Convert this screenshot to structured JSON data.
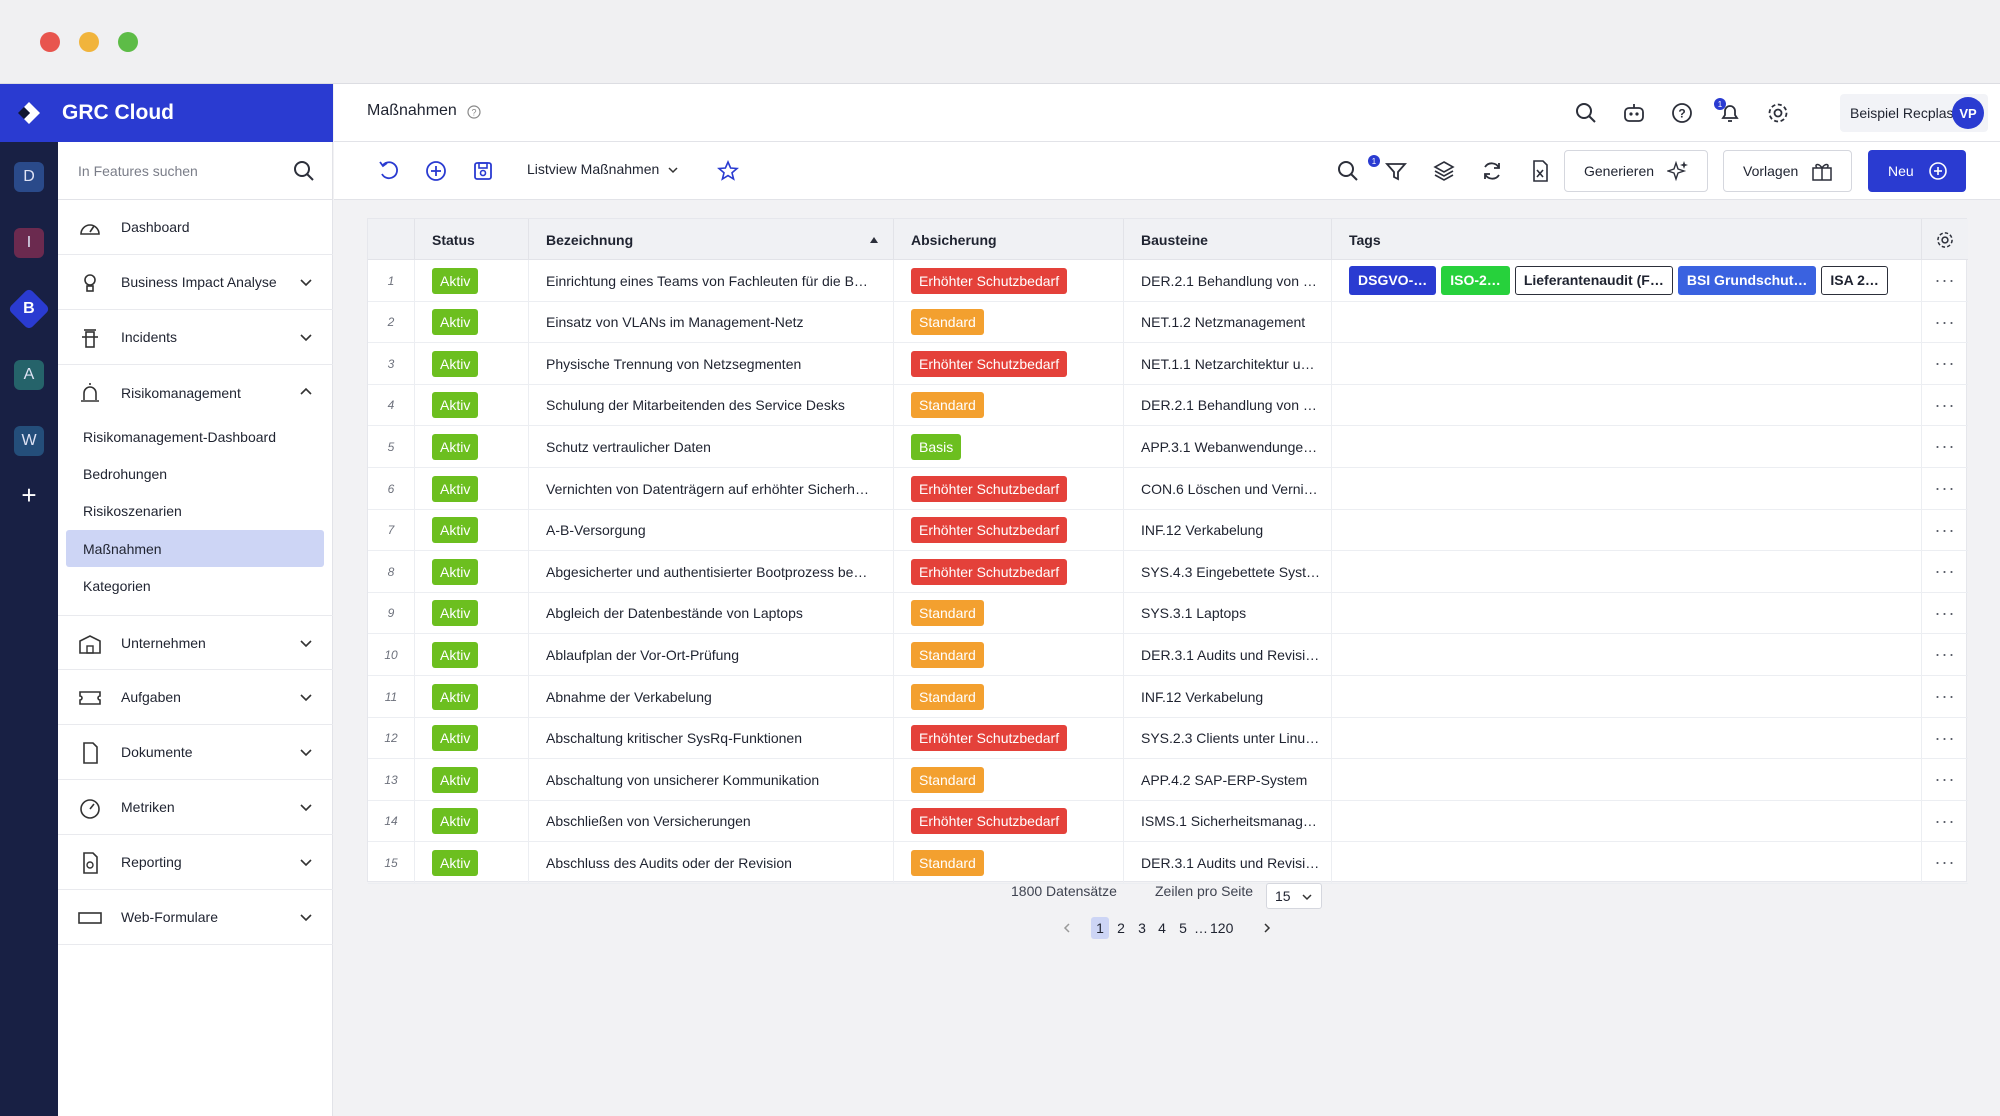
{
  "app": {
    "name": "GRC Cloud",
    "rail_items": [
      "D",
      "I",
      "B",
      "A",
      "W"
    ]
  },
  "sidebar": {
    "search_placeholder": "In Features suchen",
    "items": [
      {
        "label": "Dashboard",
        "icon": "dashboard-icon",
        "expandable": false
      },
      {
        "label": "Business Impact Analyse",
        "icon": "lightbulb-icon",
        "expandable": true
      },
      {
        "label": "Incidents",
        "icon": "fire-hydrant-icon",
        "expandable": true
      },
      {
        "label": "Risikomanagement",
        "icon": "alarm-light-icon",
        "expandable": true,
        "expanded": true
      },
      {
        "label": "Unternehmen",
        "icon": "building-icon",
        "expandable": true
      },
      {
        "label": "Aufgaben",
        "icon": "ticket-icon",
        "expandable": true
      },
      {
        "label": "Dokumente",
        "icon": "document-icon",
        "expandable": true
      },
      {
        "label": "Metriken",
        "icon": "gauge-icon",
        "expandable": true
      },
      {
        "label": "Reporting",
        "icon": "report-icon",
        "expandable": true
      },
      {
        "label": "Web-Formulare",
        "icon": "form-icon",
        "expandable": true
      }
    ],
    "sub_items": [
      "Risikomanagement-Dashboard",
      "Bedrohungen",
      "Risikoszenarien",
      "Maßnahmen",
      "Kategorien"
    ],
    "active_sub_item": "Maßnahmen"
  },
  "header": {
    "title": "Maßnahmen",
    "notification_count": "1",
    "user_name": "Beispiel Recplast",
    "user_initials": "VP"
  },
  "toolbar": {
    "view_label": "Listview Maßnahmen",
    "filter_count": "1",
    "generate_label": "Generieren",
    "templates_label": "Vorlagen",
    "new_label": "Neu"
  },
  "table": {
    "columns": [
      "Status",
      "Bezeichnung",
      "Absicherung",
      "Bausteine",
      "Tags"
    ],
    "sort_column": "Bezeichnung",
    "sort_direction": "ascending",
    "rows": [
      {
        "num": "1",
        "status": "Aktiv",
        "name": "Einrichtung eines Teams von Fachleuten für die B…",
        "level": "Erhöhter Schutzbedarf",
        "module": "DER.2.1 Behandlung von …"
      },
      {
        "num": "2",
        "status": "Aktiv",
        "name": "Einsatz von VLANs im Management-Netz",
        "level": "Standard",
        "module": "NET.1.2 Netzmanagement"
      },
      {
        "num": "3",
        "status": "Aktiv",
        "name": "Physische Trennung von Netzsegmenten",
        "level": "Erhöhter Schutzbedarf",
        "module": "NET.1.1 Netzarchitektur u…"
      },
      {
        "num": "4",
        "status": "Aktiv",
        "name": "Schulung der Mitarbeitenden des Service Desks",
        "level": "Standard",
        "module": "DER.2.1 Behandlung von …"
      },
      {
        "num": "5",
        "status": "Aktiv",
        "name": "Schutz vertraulicher Daten",
        "level": "Basis",
        "module": "APP.3.1 Webanwendunge…"
      },
      {
        "num": "6",
        "status": "Aktiv",
        "name": "Vernichten von Datenträgern auf erhöhter Sicherh…",
        "level": "Erhöhter Schutzbedarf",
        "module": "CON.6 Löschen und Verni…"
      },
      {
        "num": "7",
        "status": "Aktiv",
        "name": "A-B-Versorgung",
        "level": "Erhöhter Schutzbedarf",
        "module": "INF.12 Verkabelung"
      },
      {
        "num": "8",
        "status": "Aktiv",
        "name": "Abgesicherter und authentisierter Bootprozess be…",
        "level": "Erhöhter Schutzbedarf",
        "module": "SYS.4.3 Eingebettete Syst…"
      },
      {
        "num": "9",
        "status": "Aktiv",
        "name": "Abgleich der Datenbestände von Laptops",
        "level": "Standard",
        "module": "SYS.3.1 Laptops"
      },
      {
        "num": "10",
        "status": "Aktiv",
        "name": "Ablaufplan der Vor-Ort-Prüfung",
        "level": "Standard",
        "module": "DER.3.1 Audits und Revisi…"
      },
      {
        "num": "11",
        "status": "Aktiv",
        "name": "Abnahme der Verkabelung",
        "level": "Standard",
        "module": "INF.12 Verkabelung"
      },
      {
        "num": "12",
        "status": "Aktiv",
        "name": "Abschaltung kritischer SysRq-Funktionen",
        "level": "Erhöhter Schutzbedarf",
        "module": "SYS.2.3 Clients unter Linu…"
      },
      {
        "num": "13",
        "status": "Aktiv",
        "name": "Abschaltung von unsicherer Kommunikation",
        "level": "Standard",
        "module": "APP.4.2 SAP-ERP-System"
      },
      {
        "num": "14",
        "status": "Aktiv",
        "name": "Abschließen von Versicherungen",
        "level": "Erhöhter Schutzbedarf",
        "module": "ISMS.1 Sicherheitsmanag…"
      },
      {
        "num": "15",
        "status": "Aktiv",
        "name": "Abschluss des Audits oder der Revision",
        "level": "Standard",
        "module": "DER.3.1 Audits und Revisi…"
      }
    ],
    "row1_tags": [
      {
        "label": "DSGVO-…",
        "style": "blue"
      },
      {
        "label": "ISO-2…",
        "style": "green"
      },
      {
        "label": "Lieferantenaudit (F…",
        "style": "outline"
      },
      {
        "label": "BSI Grundschut…",
        "style": "blue-light"
      },
      {
        "label": "ISA 2…",
        "style": "outline"
      }
    ]
  },
  "pagination": {
    "record_count": "1800 Datensätze",
    "rows_per_page_label": "Zeilen pro Seite",
    "rows_per_page": "15",
    "pages": [
      "1",
      "2",
      "3",
      "4",
      "5"
    ],
    "ellipsis": "…",
    "last_page": "120",
    "current_page": "1"
  },
  "colors": {
    "brand": "#2a3bd1",
    "rail": "#182044",
    "status_active": "#6cbf1f",
    "level_high": "#e4413a",
    "level_standard": "#f3a02f",
    "level_basis": "#6cbf1f",
    "tag_blue": "#2a3bd1",
    "tag_green": "#27d13c",
    "tag_blue_light": "#3a62e0"
  }
}
